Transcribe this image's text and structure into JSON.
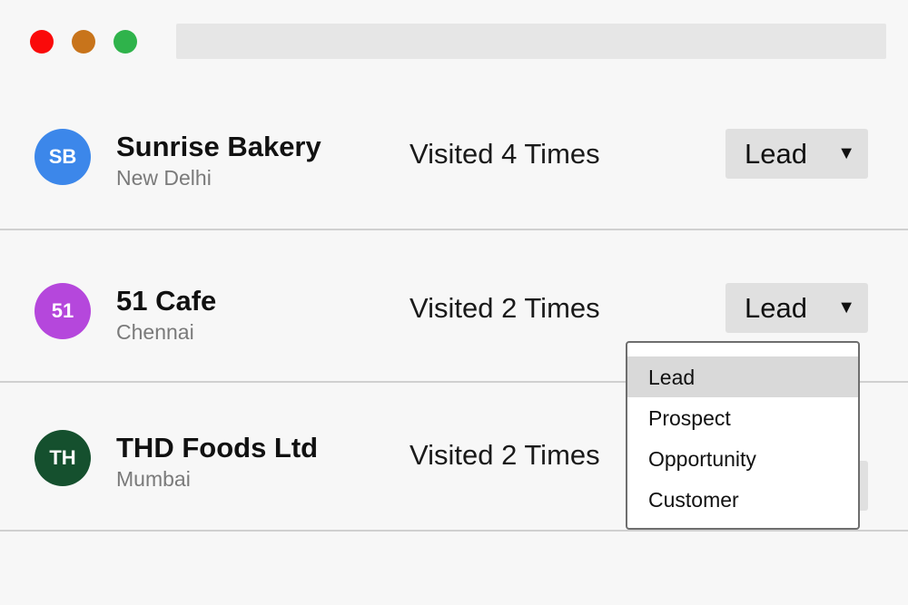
{
  "window": {
    "controls": [
      "close",
      "minimize",
      "maximize"
    ],
    "colors": {
      "close": "#fa0a0a",
      "minimize": "#c8741b",
      "maximize": "#2fb34b"
    }
  },
  "rows": [
    {
      "initials": "SB",
      "avatar_color": "#3c87ea",
      "name": "Sunrise Bakery",
      "city": "New Delhi",
      "visits": "Visited 4 Times",
      "status": "Lead"
    },
    {
      "initials": "51",
      "avatar_color": "#b547dc",
      "name": "51 Cafe",
      "city": "Chennai",
      "visits": "Visited 2 Times",
      "status": "Lead"
    },
    {
      "initials": "TH",
      "avatar_color": "#15502e",
      "name": "THD Foods Ltd",
      "city": "Mumbai",
      "visits": "Visited 2 Times",
      "status": ""
    }
  ],
  "dropdown": {
    "options": [
      "Lead",
      "Prospect",
      "Opportunity",
      "Customer"
    ],
    "selected": "Lead"
  },
  "icons": {
    "select_arrow": "caret-down-icon",
    "select_arrow_glyph": "▼"
  }
}
